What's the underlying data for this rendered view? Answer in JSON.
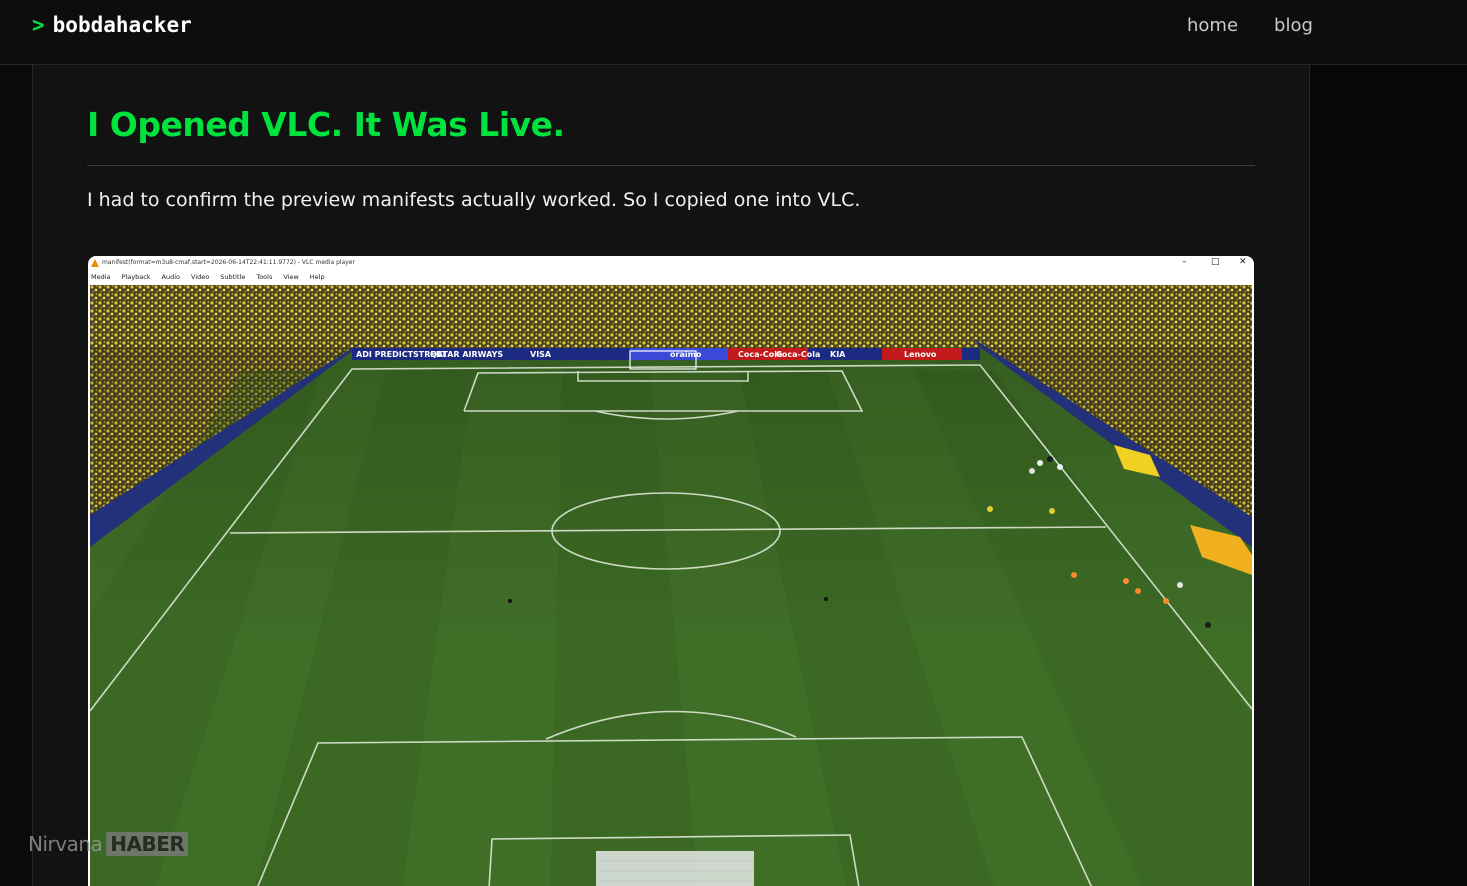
{
  "site": {
    "prompt": ">",
    "name": "bobdahacker"
  },
  "nav": {
    "home": "home",
    "blog": "blog"
  },
  "post": {
    "title": "I Opened VLC. It Was Live.",
    "intro": "I had to confirm the preview manifests actually worked. So I copied one into VLC."
  },
  "vlc": {
    "window_title": "manifest(format=m3u8-cmaf,start=2026-06-14T22:41:11.9772) - VLC media player",
    "minimize": "–",
    "maximize": "□",
    "close": "✕",
    "menu": [
      "Media",
      "Playback",
      "Audio",
      "Video",
      "Subtitle",
      "Tools",
      "View",
      "Help"
    ]
  },
  "video": {
    "ad_boards": [
      "ADI PREDICTSTREET",
      "QATAR AIRWAYS",
      "VISA",
      "oraimo",
      "Coca-Cola",
      "Coca-Cola",
      "KIA",
      "Lenovo"
    ]
  },
  "watermark": {
    "left": "Nirvana",
    "right": "HABER"
  }
}
